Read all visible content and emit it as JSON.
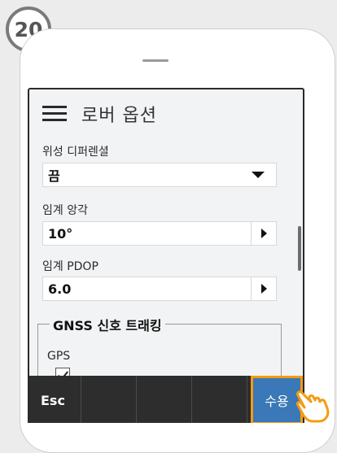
{
  "step": {
    "number": "20"
  },
  "header": {
    "title": "로버 옵션"
  },
  "fields": [
    {
      "label": "위성 디퍼렌셜",
      "value": "끔"
    },
    {
      "label": "임계 앙각",
      "value": "10°"
    },
    {
      "label": "임계 PDOP",
      "value": "6.0"
    }
  ],
  "gnss": {
    "title": "GNSS 신호 트래킹",
    "gps_label": "GPS",
    "gps_checked": true
  },
  "bottom_bar": {
    "esc_label": "Esc",
    "accept_label": "수용"
  },
  "colors": {
    "accent": "#3a78b8",
    "highlight": "#f39c12",
    "bar": "#2d2d2d"
  }
}
